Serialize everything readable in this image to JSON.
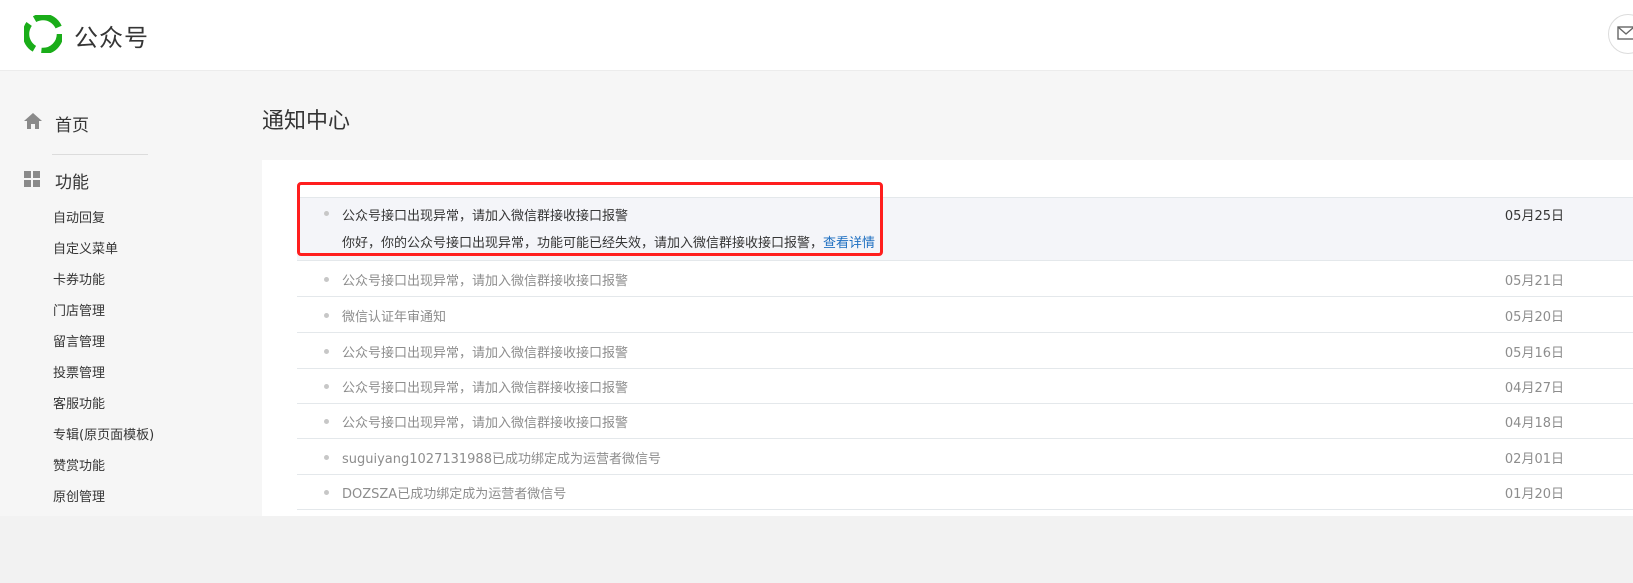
{
  "header": {
    "brand": "公众号",
    "logo_color": "#1aad19"
  },
  "sidebar": {
    "home_label": "首页",
    "function_label": "功能",
    "sub_items": [
      "自动回复",
      "自定义菜单",
      "卡券功能",
      "门店管理",
      "留言管理",
      "投票管理",
      "客服功能",
      "专辑(原页面模板)",
      "赞赏功能",
      "原创管理"
    ]
  },
  "main": {
    "title": "通知中心",
    "notifications": [
      {
        "title": "公众号接口出现异常，请加入微信群接收接口报警",
        "date": "05月25日",
        "content": "你好，你的公众号接口出现异常，功能可能已经失效，请加入微信群接收接口报警，",
        "link": "查看详情"
      },
      {
        "title": "公众号接口出现异常，请加入微信群接收接口报警",
        "date": "05月21日"
      },
      {
        "title": "微信认证年审通知",
        "date": "05月20日"
      },
      {
        "title": "公众号接口出现异常，请加入微信群接收接口报警",
        "date": "05月16日"
      },
      {
        "title": "公众号接口出现异常，请加入微信群接收接口报警",
        "date": "04月27日"
      },
      {
        "title": "公众号接口出现异常，请加入微信群接收接口报警",
        "date": "04月18日"
      },
      {
        "title": "suguiyang1027131988已成功绑定成为运营者微信号",
        "date": "02月01日"
      },
      {
        "title": "DOZSZA已成功绑定成为运营者微信号",
        "date": "01月20日"
      }
    ]
  },
  "colors": {
    "highlight": "#ff1e1e",
    "link": "#1e6fc1"
  }
}
